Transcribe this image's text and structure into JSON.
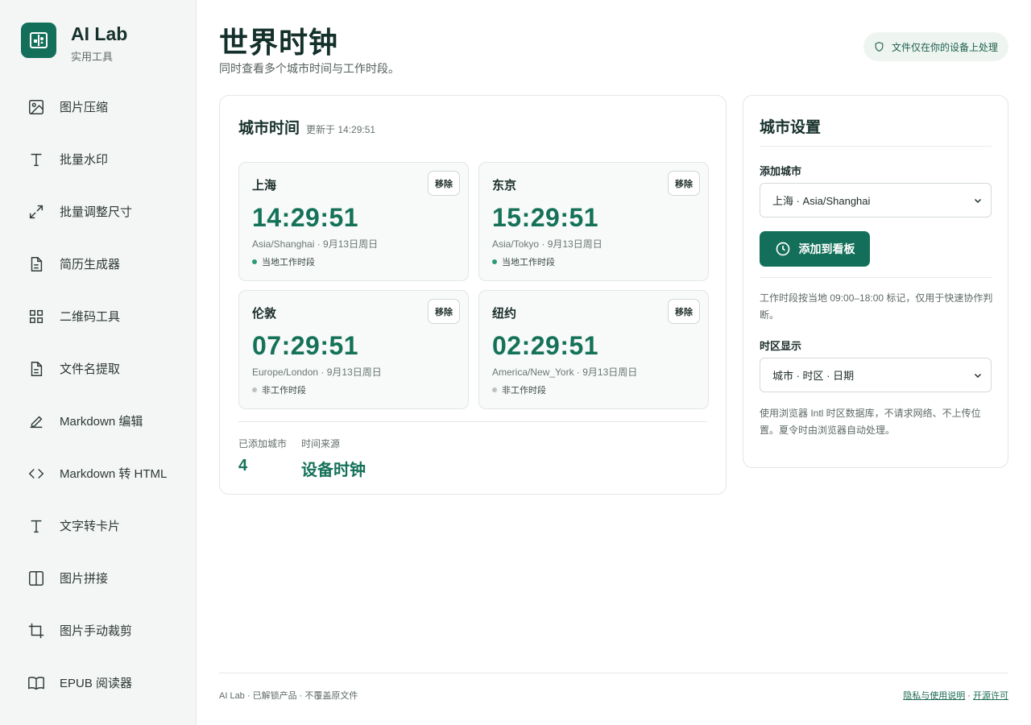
{
  "brand": {
    "name": "AI Lab",
    "subtitle": "实用工具"
  },
  "sidebar": {
    "items": [
      {
        "label": "图片压缩",
        "icon": "image-icon"
      },
      {
        "label": "批量水印",
        "icon": "text-icon"
      },
      {
        "label": "批量调整尺寸",
        "icon": "resize-icon"
      },
      {
        "label": "简历生成器",
        "icon": "document-icon"
      },
      {
        "label": "二维码工具",
        "icon": "grid-icon"
      },
      {
        "label": "文件名提取",
        "icon": "document-icon"
      },
      {
        "label": "Markdown 编辑",
        "icon": "pen-icon"
      },
      {
        "label": "Markdown 转 HTML",
        "icon": "code-icon"
      },
      {
        "label": "文字转卡片",
        "icon": "text-icon"
      },
      {
        "label": "图片拼接",
        "icon": "columns-icon"
      },
      {
        "label": "图片手动裁剪",
        "icon": "crop-icon"
      },
      {
        "label": "EPUB 阅读器",
        "icon": "book-icon"
      }
    ]
  },
  "header": {
    "title": "世界时钟",
    "subtitle": "同时查看多个城市时间与工作时段。",
    "privacy_badge": "文件仅在你的设备上处理"
  },
  "main": {
    "title": "城市时间",
    "updated": "更新于 14:29:51",
    "remove_label": "移除",
    "cities": [
      {
        "name": "上海",
        "time": "14:29:51",
        "zone": "Asia/Shanghai · 9月13日周日",
        "status": "当地工作时段"
      },
      {
        "name": "东京",
        "time": "15:29:51",
        "zone": "Asia/Tokyo · 9月13日周日",
        "status": "当地工作时段"
      },
      {
        "name": "伦敦",
        "time": "07:29:51",
        "zone": "Europe/London · 9月13日周日",
        "status": "非工作时段"
      },
      {
        "name": "纽约",
        "time": "02:29:51",
        "zone": "America/New_York · 9月13日周日",
        "status": "非工作时段"
      }
    ],
    "stats": {
      "count_label": "已添加城市",
      "count_value": "4",
      "source_label": "时间来源",
      "source_value": "设备时钟"
    }
  },
  "settings": {
    "title": "城市设置",
    "add_city_label": "添加城市",
    "add_city_value": "上海 · Asia/Shanghai",
    "add_button": "添加到看板",
    "work_note": "工作时段按当地 09:00–18:00 标记，仅用于快速协作判断。",
    "display_label": "时区显示",
    "display_value": "城市 · 时区 · 日期",
    "tz_note": "使用浏览器 Intl 时区数据库，不请求网络、不上传位置。夏令时由浏览器自动处理。"
  },
  "footer": {
    "left": "AI Lab · 已解锁产品 · 不覆盖原文件",
    "privacy_link": "隐私与使用说明",
    "sep": "·",
    "license_link": "开源许可"
  },
  "colors": {
    "accent": "#136f59",
    "accent_text": "#157258",
    "working_dot": "#2d9a74",
    "offwork_dot": "#bcc3c1"
  }
}
